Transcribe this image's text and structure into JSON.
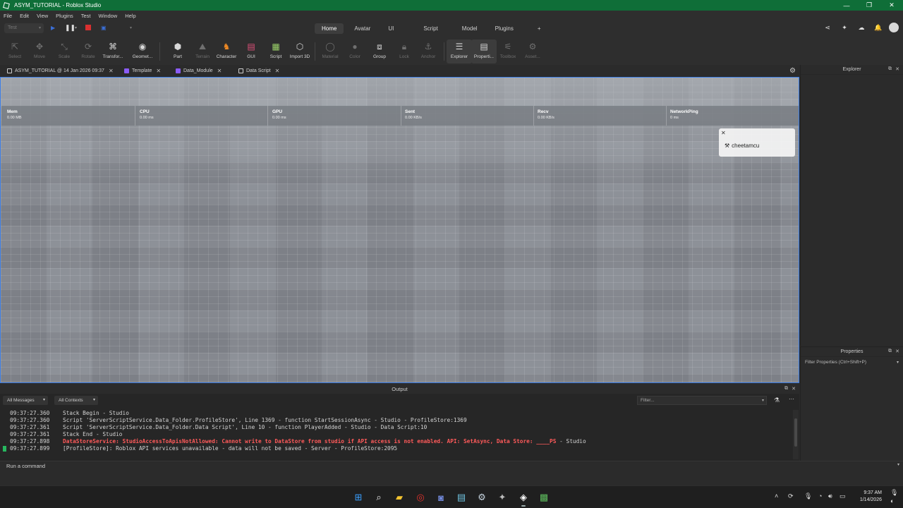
{
  "window": {
    "title": "ASYM_TUTORIAL - Roblox Studio"
  },
  "win_controls": {
    "minimize": "—",
    "maximize": "❐",
    "close": "✕"
  },
  "menu": [
    "File",
    "Edit",
    "View",
    "Plugins",
    "Test",
    "Window",
    "Help"
  ],
  "mode": {
    "test_select": "Test",
    "tabs": [
      "Home",
      "Avatar",
      "UI",
      "Script",
      "Model",
      "Plugins"
    ],
    "active_tab": "Home",
    "add": "+"
  },
  "toolbar": {
    "select": "Select",
    "move": "Move",
    "scale": "Scale",
    "rotate": "Rotate",
    "transform": "Transfor...",
    "geometry": "Geomet...",
    "part": "Part",
    "terrain": "Terrain",
    "character": "Character",
    "gui": "GUI",
    "script": "Script",
    "import3d": "Import 3D",
    "material": "Material",
    "color": "Color",
    "group": "Group",
    "lock": "Lock",
    "anchor": "Anchor",
    "explorer": "Explorer",
    "properties": "Properti...",
    "toolbox": "Toolbox",
    "asset": "Asset..."
  },
  "doc_tabs": [
    {
      "label": "ASYM_TUTORIAL @ 14 Jan 2026 09:37",
      "color": "#d0d0d0"
    },
    {
      "label": "Template",
      "color": "#8b5cf6"
    },
    {
      "label": "Data_Module",
      "color": "#8b5cf6"
    },
    {
      "label": "Data Script",
      "color": "#d0d0d0"
    }
  ],
  "stats": [
    {
      "name": "Mem",
      "value": "0.00 MB"
    },
    {
      "name": "CPU",
      "value": "0.00 ms"
    },
    {
      "name": "GPU",
      "value": "0.00 ms"
    },
    {
      "name": "Sent",
      "value": "0.00 KB/s"
    },
    {
      "name": "Recv",
      "value": "0.00 KB/s"
    },
    {
      "name": "NetworkPing",
      "value": "0 ms"
    }
  ],
  "player": {
    "name": "cheetamcu"
  },
  "explorer": {
    "title": "Explorer"
  },
  "properties": {
    "title": "Properties",
    "filter": "Filter Properties (Ctrl+Shift+P)"
  },
  "output": {
    "title": "Output",
    "messages_filter": "All Messages",
    "contexts_filter": "All Contexts",
    "filter_placeholder": "Filter...",
    "lines": [
      {
        "ts": "09:37:27.360",
        "text": "Stack Begin  -  Studio"
      },
      {
        "ts": "09:37:27.360",
        "text": "Script 'ServerScriptService.Data_Folder.ProfileStore', Line 1369 - function StartSessionAsync  -  Studio - ProfileStore:1369"
      },
      {
        "ts": "09:37:27.361",
        "text": "Script 'ServerScriptService.Data_Folder.Data Script', Line 10 - function PlayerAdded  -  Studio - Data Script:10"
      },
      {
        "ts": "09:37:27.361",
        "text": "Stack End  -  Studio"
      },
      {
        "ts": "09:37:27.898",
        "text": "DataStoreService: StudioAccessToApisNotAllowed: Cannot write to DataStore from studio if API access is not enabled. API: SetAsync, Data Store: ____PS",
        "tail": "  -  Studio"
      },
      {
        "ts": "09:37:27.899",
        "text": "[ProfileStore]: Roblox API services unavailable - data will not be saved  -  Server - ProfileStore:2095"
      }
    ]
  },
  "command": {
    "placeholder": "Run a command"
  },
  "taskbar": {
    "time": "9:37 AM",
    "date": "1/14/2026",
    "apps": [
      "windows-start",
      "search",
      "file-explorer",
      "opera",
      "discord",
      "notepad",
      "steam",
      "davinci",
      "roblox-studio",
      "minecraft"
    ]
  },
  "colors": {
    "title_bar": "#0f6e38",
    "viewport_border": "#3b7de6",
    "error": "#ff5a5a"
  }
}
